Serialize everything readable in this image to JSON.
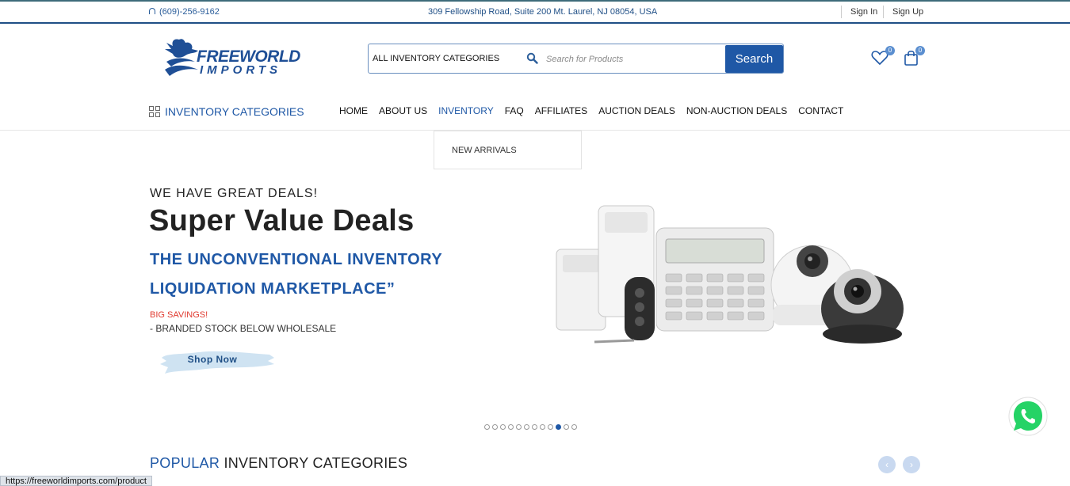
{
  "topbar": {
    "phone": "(609)-256-9162",
    "address": "309 Fellowship Road, Suite 200 Mt. Laurel, NJ 08054, USA",
    "sign_in": "Sign In",
    "sign_up": "Sign Up"
  },
  "logo": {
    "line1": "FREEWORLD",
    "line2": "IMPORTS"
  },
  "search": {
    "category": "ALL INVENTORY CATEGORIES",
    "placeholder": "Search for Products",
    "button": "Search"
  },
  "header_icons": {
    "wishlist_count": "0",
    "cart_count": "0"
  },
  "categories_button": "INVENTORY CATEGORIES",
  "nav": {
    "items": [
      {
        "label": "HOME"
      },
      {
        "label": "ABOUT US"
      },
      {
        "label": "INVENTORY"
      },
      {
        "label": "FAQ"
      },
      {
        "label": "AFFILIATES"
      },
      {
        "label": "AUCTION DEALS"
      },
      {
        "label": "NON-AUCTION DEALS"
      },
      {
        "label": "CONTACT"
      }
    ],
    "dropdown_item": "NEW ARRIVALS"
  },
  "hero": {
    "kicker": "WE HAVE GREAT DEALS!",
    "title": "Super Value Deals",
    "subtitle_line1": "THE UNCONVENTIONAL INVENTORY",
    "subtitle_line2": "LIQUIDATION MARKETPLACE”",
    "highlight": "BIG SAVINGS!",
    "description": "- BRANDED STOCK BELOW WHOLESALE",
    "button": "Shop Now"
  },
  "slider": {
    "total_dots": 12,
    "active_index": 9
  },
  "popular": {
    "word1": "POPULAR",
    "rest": "INVENTORY CATEGORIES"
  },
  "status_url": "https://freeworldimports.com/product",
  "colors": {
    "brand_blue": "#1f58a6",
    "accent_red": "#e03a2f",
    "whatsapp_green": "#25d366"
  }
}
